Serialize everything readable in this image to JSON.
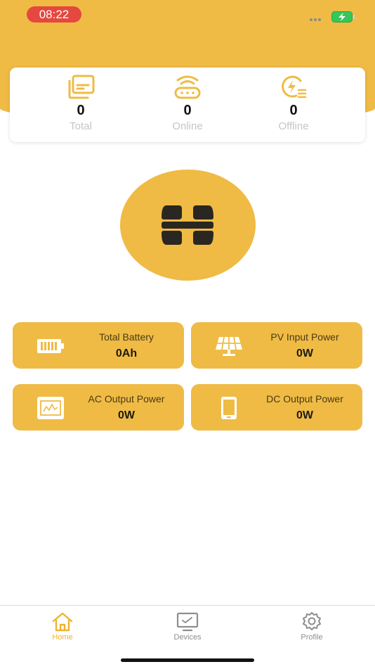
{
  "status_bar": {
    "time": "08:22"
  },
  "stats": [
    {
      "value": "0",
      "label": "Total"
    },
    {
      "value": "0",
      "label": "Online"
    },
    {
      "value": "0",
      "label": "Offline"
    }
  ],
  "tiles": [
    {
      "label": "Total Battery",
      "value": "0Ah",
      "icon": "battery-icon"
    },
    {
      "label": "PV Input Power",
      "value": "0W",
      "icon": "solar-panel-icon"
    },
    {
      "label": "AC Output Power",
      "value": "0W",
      "icon": "ac-monitor-icon"
    },
    {
      "label": "DC Output Power",
      "value": "0W",
      "icon": "phone-icon"
    }
  ],
  "tabs": [
    {
      "label": "Home",
      "icon": "home-icon",
      "active": true
    },
    {
      "label": "Devices",
      "icon": "monitor-icon",
      "active": false
    },
    {
      "label": "Profile",
      "icon": "gear-icon",
      "active": false
    }
  ],
  "colors": {
    "accent": "#EFBB45",
    "tab_active": "#EFB232",
    "tab_inactive": "#8e8e8e",
    "time_badge": "#E5483E",
    "battery_green": "#34C759"
  }
}
